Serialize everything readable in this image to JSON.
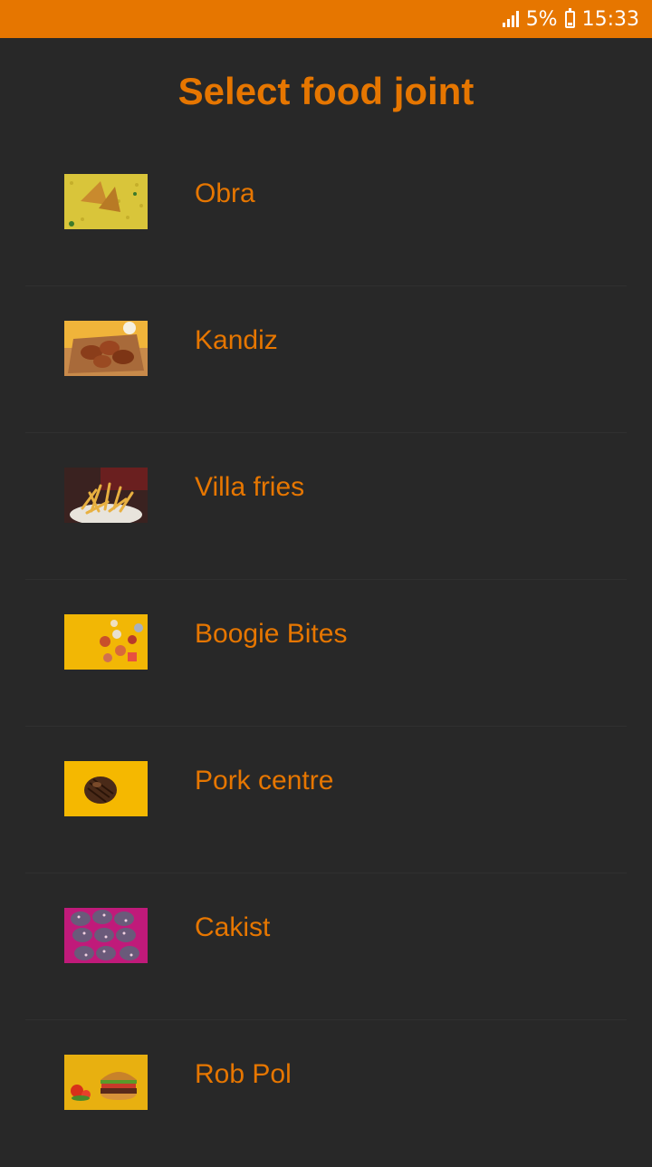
{
  "status_bar": {
    "battery_percent": "5%",
    "time": "15:33",
    "icons": [
      "signal-icon",
      "battery-charging-icon"
    ]
  },
  "page_title": "Select food joint",
  "joints": [
    {
      "name": "Obra",
      "image": "samosa-image"
    },
    {
      "name": "Kandiz",
      "image": "chicken-wings-image"
    },
    {
      "name": "Villa fries",
      "image": "french-fries-image"
    },
    {
      "name": "Boogie Bites",
      "image": "snacks-image"
    },
    {
      "name": "Pork centre",
      "image": "grilled-meat-image"
    },
    {
      "name": "Cakist",
      "image": "cupcakes-image"
    },
    {
      "name": "Rob Pol",
      "image": "burger-image"
    }
  ],
  "colors": {
    "accent": "#e67600",
    "background": "#282828"
  }
}
